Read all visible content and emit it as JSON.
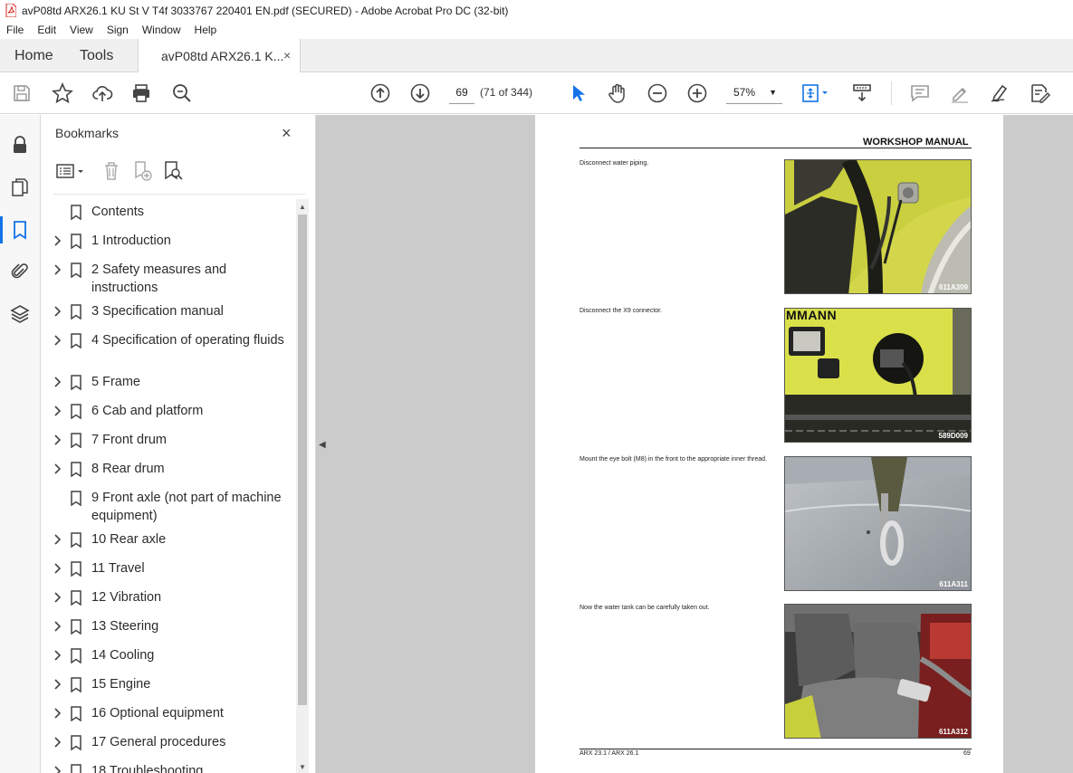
{
  "window": {
    "title": "avP08td ARX26.1 KU St V T4f 3033767 220401 EN.pdf (SECURED) - Adobe Acrobat Pro DC (32-bit)"
  },
  "menu": [
    "File",
    "Edit",
    "View",
    "Sign",
    "Window",
    "Help"
  ],
  "tabs": {
    "home": "Home",
    "tools": "Tools",
    "doc": "avP08td ARX26.1 K...",
    "close": "×"
  },
  "toolbar": {
    "page_current": "69",
    "page_count": "(71 of 344)",
    "zoom": "57%",
    "zoom_caret": "▼"
  },
  "bookmarks": {
    "title": "Bookmarks",
    "close": "×",
    "items": [
      {
        "label": "Contents",
        "expandable": false
      },
      {
        "label": "1 Introduction",
        "expandable": true
      },
      {
        "label": "2 Safety measures and instructions",
        "expandable": true
      },
      {
        "label": "3 Specification manual",
        "expandable": true
      },
      {
        "label": "4 Specification of operating fluids",
        "expandable": true
      },
      {
        "label": "5 Frame",
        "expandable": true
      },
      {
        "label": "6 Cab and platform",
        "expandable": true
      },
      {
        "label": "7 Front drum",
        "expandable": true
      },
      {
        "label": "8 Rear drum",
        "expandable": true
      },
      {
        "label": "9 Front axle (not part of machine equipment)",
        "expandable": false
      },
      {
        "label": "10 Rear axle",
        "expandable": true
      },
      {
        "label": "11 Travel",
        "expandable": true
      },
      {
        "label": "12 Vibration",
        "expandable": true
      },
      {
        "label": "13 Steering",
        "expandable": true
      },
      {
        "label": "14 Cooling",
        "expandable": true
      },
      {
        "label": "15 Engine",
        "expandable": true
      },
      {
        "label": "16 Optional equipment",
        "expandable": true
      },
      {
        "label": "17 General procedures",
        "expandable": true
      },
      {
        "label": "18 Troubleshooting",
        "expandable": true
      }
    ]
  },
  "page": {
    "header": "WORKSHOP MANUAL",
    "footer_left": "ARX 23.1 / ARX 26.1",
    "footer_right": "69",
    "steps": [
      {
        "text": "Disconnect water piping.",
        "code": "611A309"
      },
      {
        "text": "Disconnect the X9 connector.",
        "code": "589D009"
      },
      {
        "text": "Mount the eye bolt (M8) in the front to the appropriate inner thread.",
        "code": "611A311"
      },
      {
        "text": "Now the water tank can be carefully taken out.",
        "code": "611A312"
      }
    ],
    "photo2_brand": "MMANN"
  },
  "colors": {
    "accent": "#1473e6",
    "pdf_red": "#d7261e",
    "machine_yellow": "#d9e04a"
  }
}
